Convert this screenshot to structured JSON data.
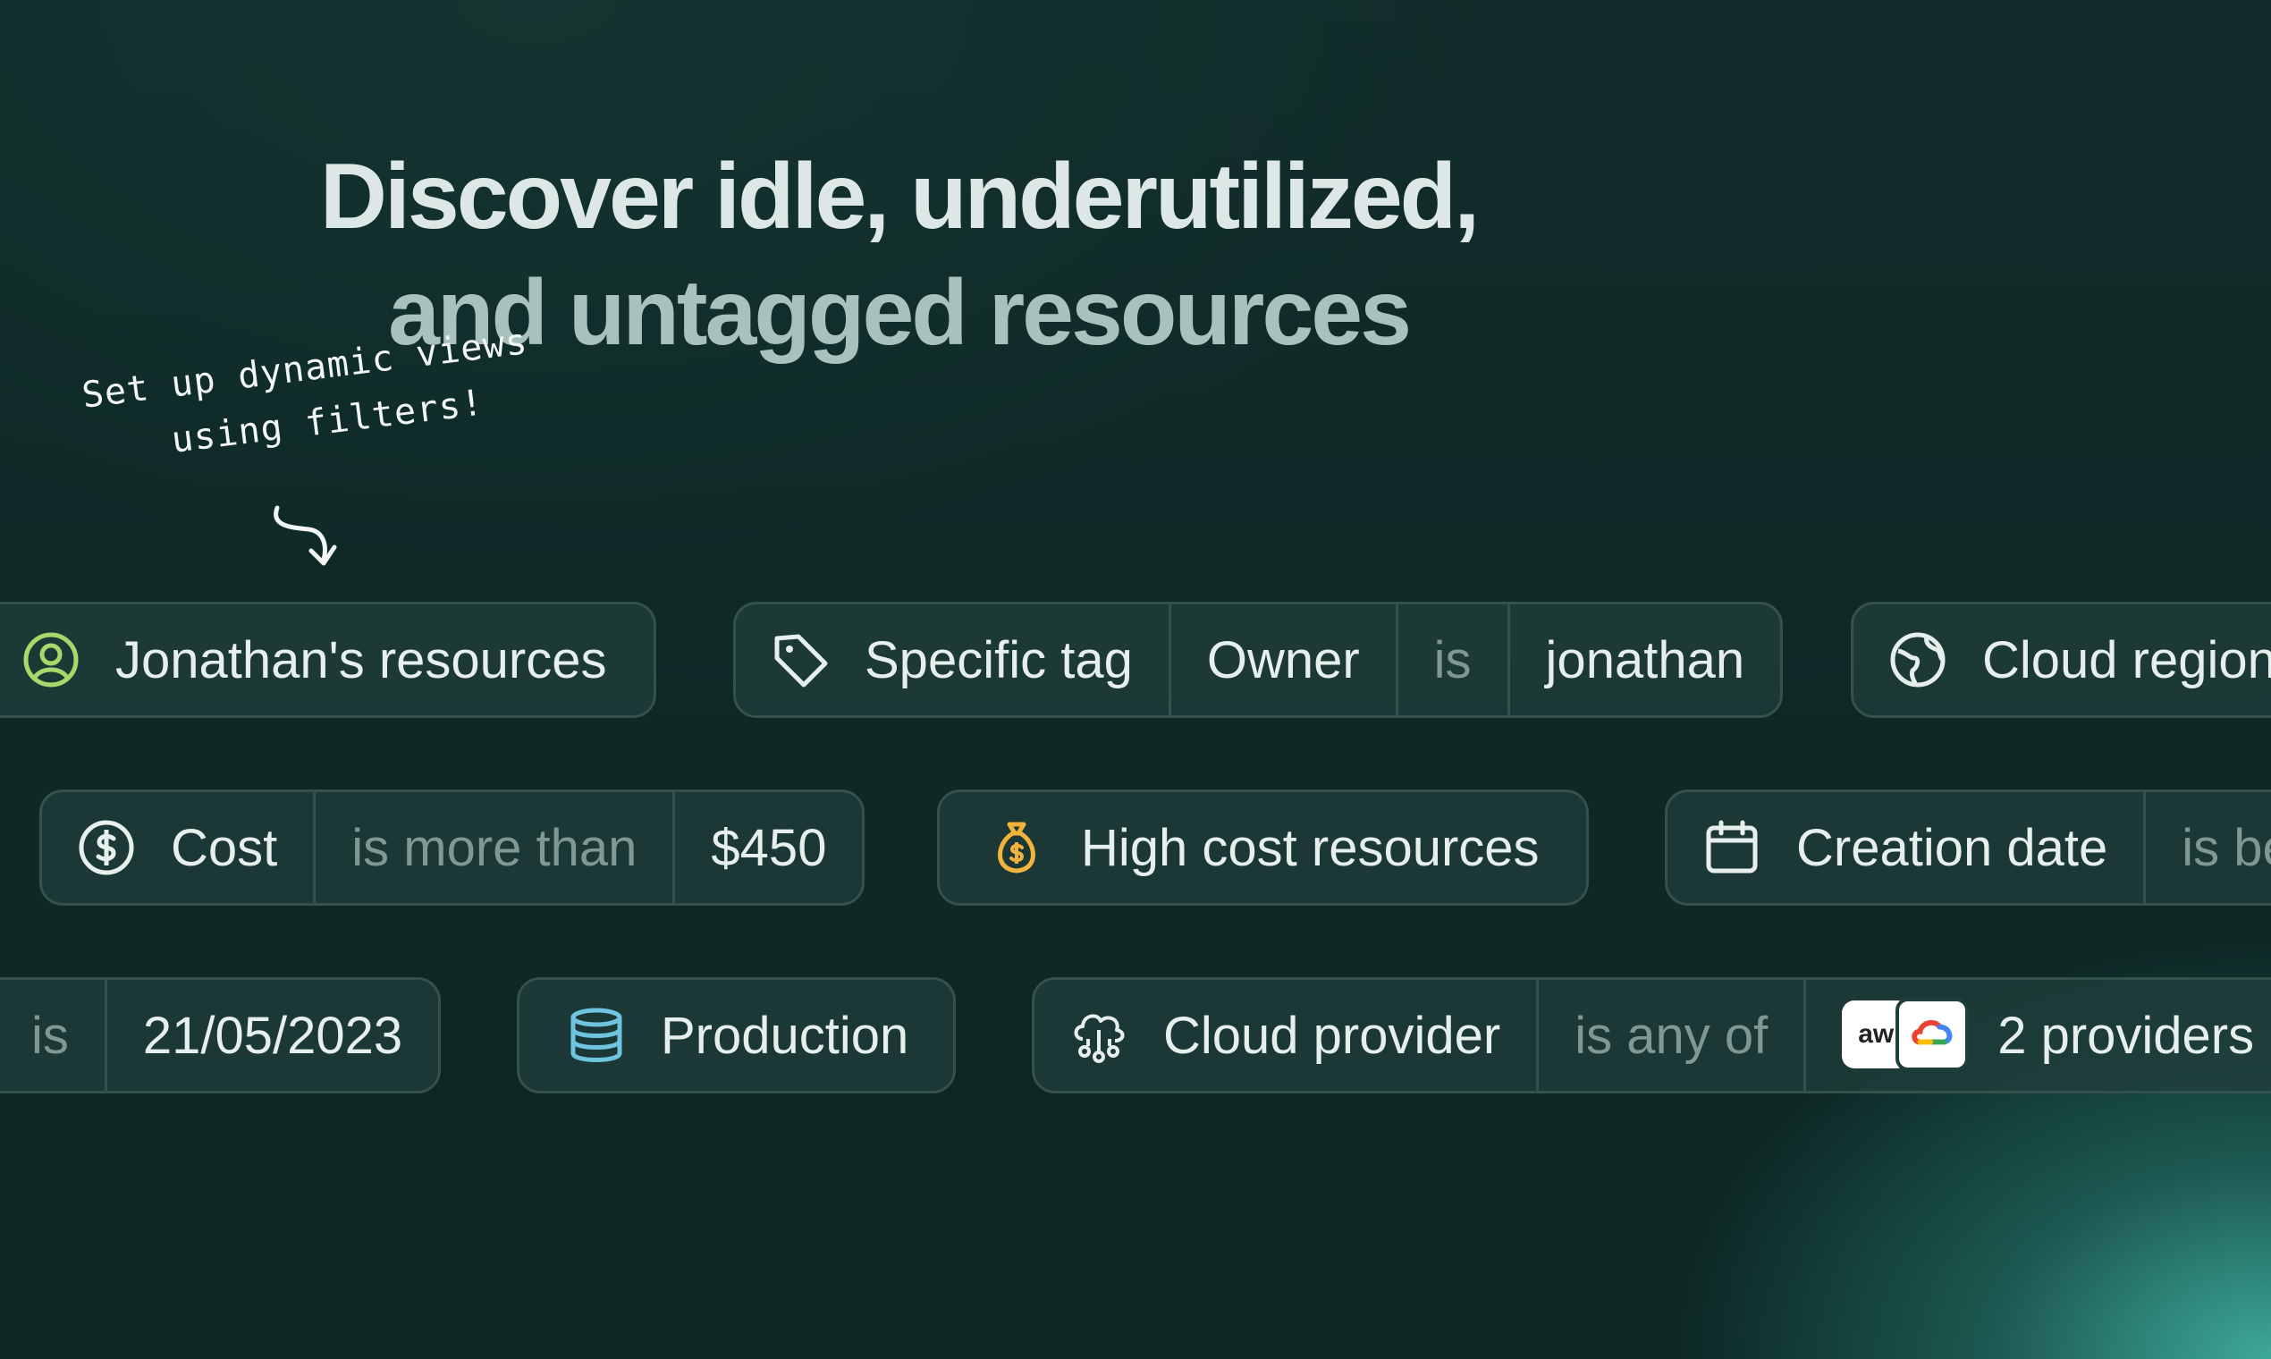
{
  "headline": {
    "line1": "Discover idle, underutilized,",
    "line2": "and untagged resources"
  },
  "annotation": {
    "line1": "Set up dynamic views",
    "line2": "using filters!"
  },
  "colors": {
    "background": "#0f2a29",
    "chip_border": "#34514e",
    "accent_green": "#a6d96a",
    "accent_gold": "#f2b33d",
    "accent_blue": "#6fc4e0",
    "glow": "#40b0a0"
  },
  "rows": [
    {
      "chips": [
        {
          "icon": "user-circle-icon",
          "segments": [
            "Jonathan's resources"
          ]
        },
        {
          "icon": "tag-icon",
          "segments": [
            "Specific tag",
            "Owner",
            "is",
            "jonathan"
          ]
        },
        {
          "icon": "globe-icon",
          "segments": [
            "Cloud region"
          ]
        }
      ]
    },
    {
      "chips": [
        {
          "icon": "dollar-circle-icon",
          "segments": [
            "Cost",
            "is more than",
            "$450"
          ]
        },
        {
          "icon": "money-bag-icon",
          "segments": [
            "High cost resources"
          ]
        },
        {
          "icon": "calendar-icon",
          "segments": [
            "Creation date",
            "is be"
          ]
        }
      ]
    },
    {
      "chips": [
        {
          "icon": "",
          "segments": [
            "is",
            "21/05/2023"
          ]
        },
        {
          "icon": "database-icon",
          "segments": [
            "Production"
          ]
        },
        {
          "icon": "cloud-network-icon",
          "segments": [
            "Cloud provider",
            "is any of",
            "2 providers"
          ],
          "providers": [
            "aws",
            "google-cloud"
          ]
        }
      ]
    }
  ]
}
